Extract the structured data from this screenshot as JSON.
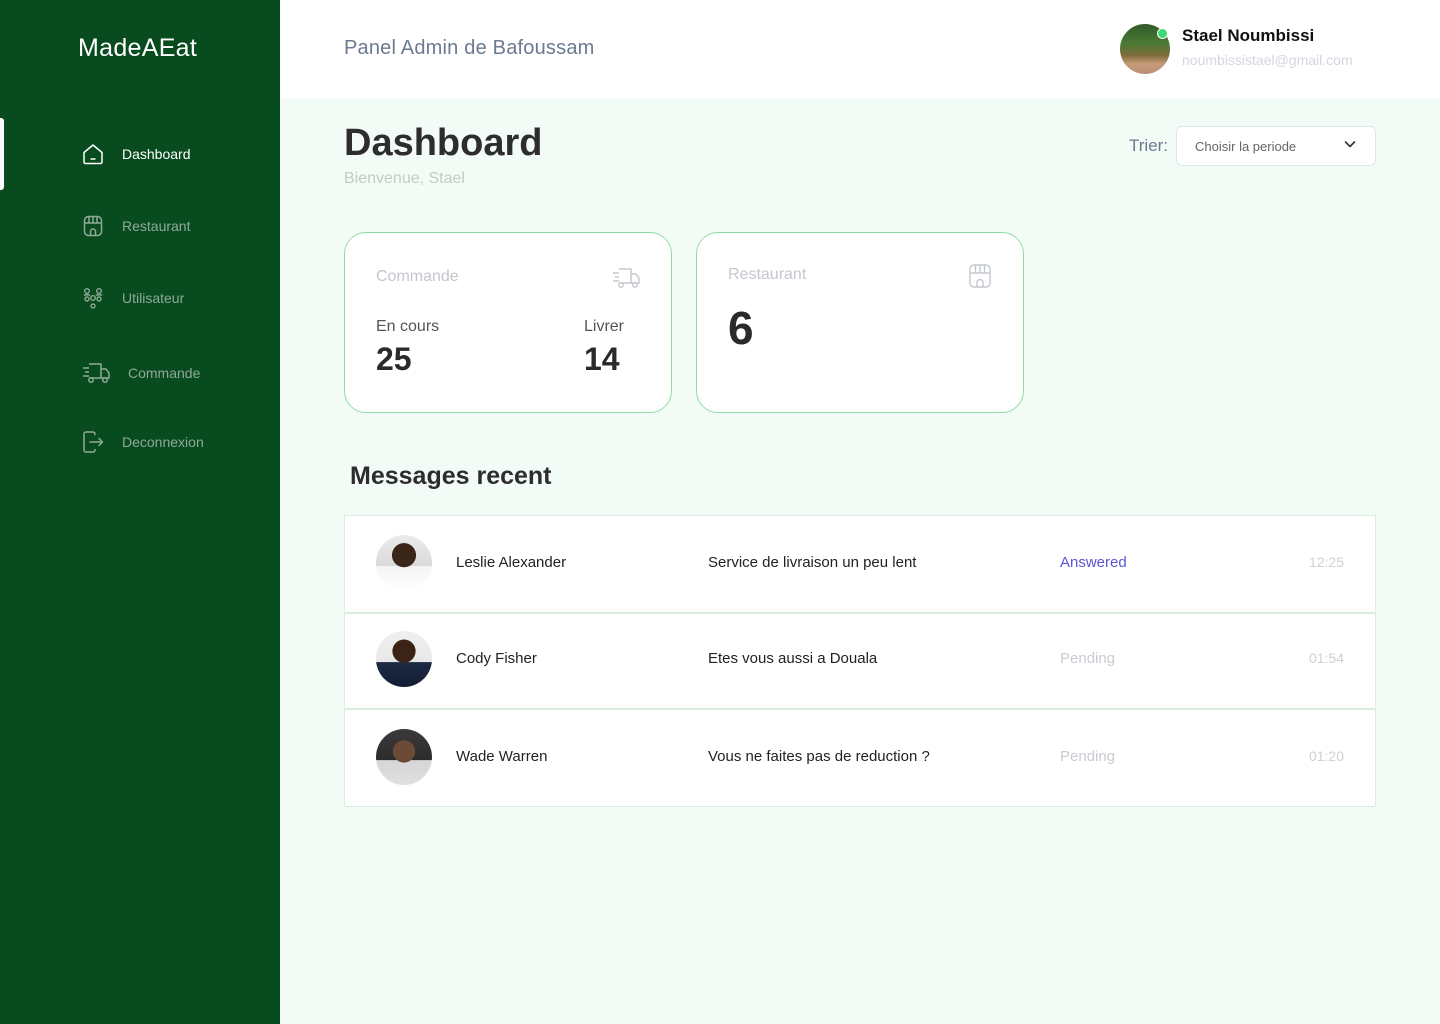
{
  "app": {
    "brand": "MadeAEat"
  },
  "sidebar": {
    "items": [
      {
        "label": "Dashboard",
        "icon": "home-icon",
        "active": true
      },
      {
        "label": "Restaurant",
        "icon": "store-icon",
        "active": false
      },
      {
        "label": "Utilisateur",
        "icon": "users-icon",
        "active": false
      },
      {
        "label": "Commande",
        "icon": "delivery-truck-icon",
        "active": false
      },
      {
        "label": "Deconnexion",
        "icon": "logout-icon",
        "active": false
      }
    ]
  },
  "header": {
    "title": "Panel Admin de Bafoussam",
    "user": {
      "name": "Stael Noumbissi",
      "email": "noumbissistael@gmail.com",
      "status": "online"
    }
  },
  "main": {
    "title": "Dashboard",
    "subtitle": "Bienvenue, Stael",
    "sort": {
      "label": "Trier:",
      "placeholder": "Choisir la periode"
    }
  },
  "cards": {
    "commande": {
      "title": "Commande",
      "icon": "delivery-truck-icon",
      "en_cours_label": "En cours",
      "en_cours_value": "25",
      "livrer_label": "Livrer",
      "livrer_value": "14"
    },
    "restaurant": {
      "title": "Restaurant",
      "icon": "store-icon",
      "value": "6"
    }
  },
  "messages": {
    "title": "Messages recent",
    "rows": [
      {
        "name": "Leslie Alexander",
        "text": "Service de livraison un peu lent",
        "status": "Answered",
        "time": "12:25"
      },
      {
        "name": "Cody Fisher",
        "text": "Etes vous aussi a Douala",
        "status": "Pending",
        "time": "01:54"
      },
      {
        "name": "Wade Warren",
        "text": "Vous ne faites pas de reduction ?",
        "status": "Pending",
        "time": "01:20"
      }
    ]
  },
  "colors": {
    "sidebar_bg": "#084b1f",
    "page_bg": "#f3fbf6",
    "card_border": "#8fdca3",
    "answered": "#5a55d6",
    "online": "#3ddc72"
  }
}
